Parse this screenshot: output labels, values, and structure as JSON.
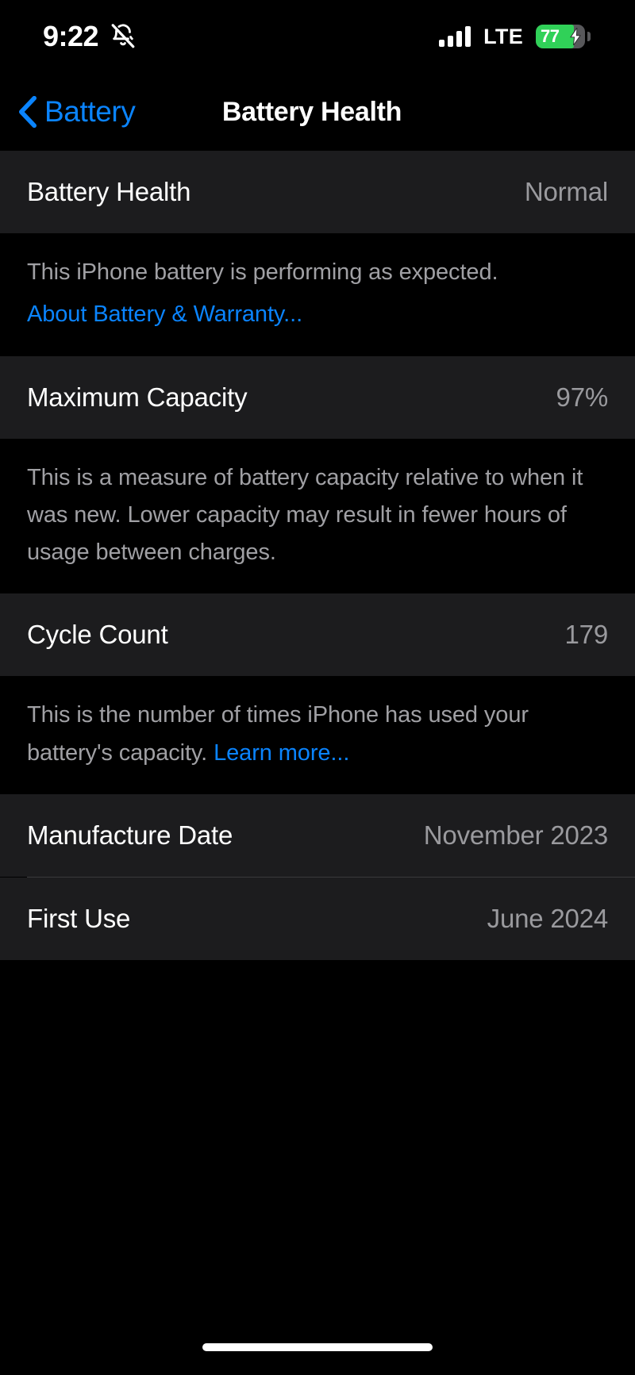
{
  "status_bar": {
    "time": "9:22",
    "silent_icon": "bell-slash-icon",
    "signal_icon": "cellular-bars-icon",
    "carrier": "LTE",
    "battery_percent": "77",
    "battery_level": 77,
    "battery_charging": true,
    "battery_color": "#30d158"
  },
  "nav": {
    "back_label": "Battery",
    "title": "Battery Health",
    "accent_color": "#0a84ff"
  },
  "sections": {
    "battery_health": {
      "label": "Battery Health",
      "value": "Normal",
      "footer_text": "This iPhone battery is performing as expected.",
      "footer_link": "About Battery & Warranty..."
    },
    "maximum_capacity": {
      "label": "Maximum Capacity",
      "value": "97%",
      "footer_text": "This is a measure of battery capacity relative to when it was new. Lower capacity may result in fewer hours of usage between charges."
    },
    "cycle_count": {
      "label": "Cycle Count",
      "value": "179",
      "footer_text": "This is the number of times iPhone has used your battery's capacity. ",
      "footer_link": "Learn more..."
    },
    "dates": {
      "manufacture_label": "Manufacture Date",
      "manufacture_value": "November 2023",
      "first_use_label": "First Use",
      "first_use_value": "June 2024"
    }
  },
  "home_indicator": "home-indicator-bar"
}
